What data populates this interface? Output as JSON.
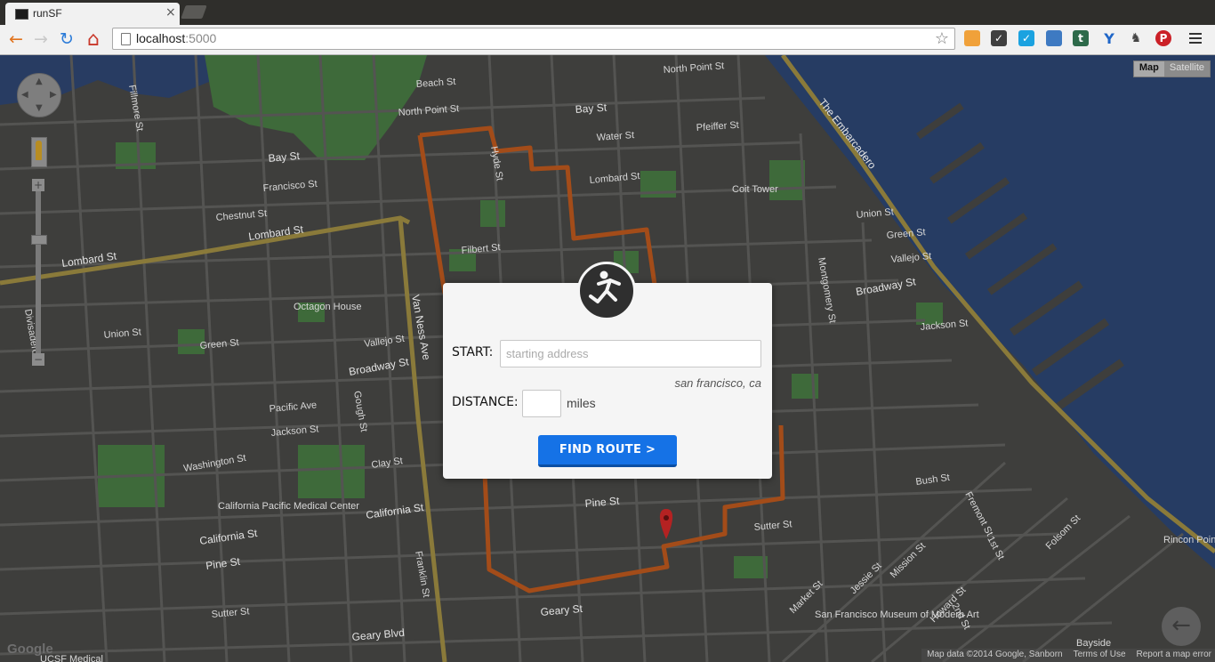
{
  "browser": {
    "tab_title": "runSF",
    "tab_close": "×",
    "url_host": "localhost",
    "url_port": ":5000",
    "nav": {
      "back_icon": "←",
      "forward_icon": "→",
      "reload_icon": "↻",
      "home_icon": "⌂"
    },
    "extensions": [
      "hand-icon",
      "pocket-icon",
      "check-icon",
      "image-icon",
      "tumblr-icon",
      "ycombinator-icon",
      "evernote-icon",
      "pinterest-icon"
    ]
  },
  "map": {
    "type_options": {
      "map": "Map",
      "satellite": "Satellite"
    },
    "google_logo": "Google",
    "footer": {
      "data": "Map data ©2014 Google, Sanborn",
      "terms": "Terms of Use",
      "report": "Report a map error"
    },
    "back_arrow": "←",
    "streets": {
      "lombard_left": "Lombard St",
      "lombard_mid": "Lombard St",
      "bay_left": "Bay St",
      "bay_right": "Bay St",
      "broadway_mid": "Broadway St",
      "broadway_right": "Broadway St",
      "van_ness": "Van Ness Ave",
      "california_left": "California St",
      "california_mid": "California St",
      "pine_left": "Pine St",
      "pine_mid": "Pine St",
      "geary": "Geary St",
      "geary_blvd": "Geary Blvd",
      "sutter_left": "Sutter St",
      "embarcadero": "The Embarcadero",
      "north_point": "North Point St",
      "north_point_right": "North Point St",
      "beach": "Beach St",
      "francisco": "Francisco St",
      "chestnut": "Chestnut St",
      "union": "Union St",
      "green": "Green St",
      "vallejo": "Vallejo St",
      "pacific": "Pacific Ave",
      "jackson": "Jackson St",
      "washington": "Washington St",
      "clay": "Clay St",
      "fillmore": "Fillmore St",
      "gough": "Gough St",
      "franklin": "Franklin St",
      "octagon_house": "Octagon House",
      "cpmc": "California Pacific Medical Center",
      "coit_tower": "Coit Tower",
      "market": "Market St",
      "mission": "Mission St",
      "folsom": "Folsom St",
      "fremont": "Fremont St",
      "first": "1st St",
      "second": "2nd St",
      "bush": "Bush St",
      "sfmoma": "San Francisco Museum of Modern Art",
      "bayside": "Bayside",
      "rincon": "Rincon Point",
      "ucsf": "UCSF Medical",
      "divisadero": "Divisadero",
      "filbert": "Filbert St",
      "lombard_small": "Lombard St",
      "pfeiffer": "Pfeiffer St",
      "water": "Water St",
      "montgomery": "Montgomery St",
      "union_right": "Union St",
      "green_right": "Green St",
      "vallejo_right": "Vallejo St",
      "jackson_right": "Jackson St",
      "sutter_right": "Sutter St",
      "jessie": "Jessie St",
      "howard": "Howard St",
      "hyde": "Hyde St"
    }
  },
  "form": {
    "start_label": "START:",
    "start_placeholder": "starting address",
    "hint": "san francisco, ca",
    "distance_label": "DISTANCE:",
    "distance_value": "",
    "units": "miles",
    "submit": "FIND ROUTE >"
  },
  "colors": {
    "map_bg": "#3c3c3a",
    "water": "#263c63",
    "park": "#3e6a3a",
    "route": "#a34c19",
    "arterial": "#8a7a3a",
    "button": "#1572e6"
  }
}
